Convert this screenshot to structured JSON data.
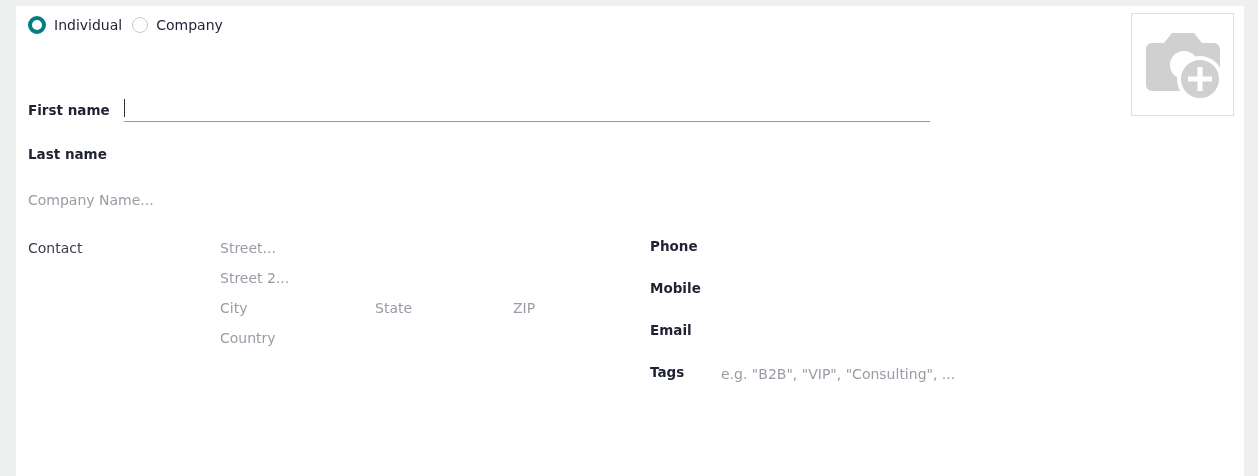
{
  "company_type": [
    {
      "label": "Individual",
      "selected": true
    },
    {
      "label": "Company",
      "selected": false
    }
  ],
  "name_fields": [
    {
      "label": "First name",
      "focused": true
    },
    {
      "label": "Last name",
      "focused": false
    }
  ],
  "company_name": {
    "placeholder": "Company Name..."
  },
  "contact": {
    "label": "Contact",
    "street": {
      "placeholder": "Street..."
    },
    "street2": {
      "placeholder": "Street 2..."
    },
    "city": {
      "placeholder": "City"
    },
    "state": {
      "placeholder": "State"
    },
    "zip": {
      "placeholder": "ZIP"
    },
    "country": {
      "placeholder": "Country"
    }
  },
  "right_fields": [
    {
      "label": "Phone"
    },
    {
      "label": "Mobile"
    },
    {
      "label": "Email"
    },
    {
      "label": "Tags",
      "placeholder": "e.g. \"B2B\", \"VIP\", \"Consulting\", ..."
    }
  ]
}
